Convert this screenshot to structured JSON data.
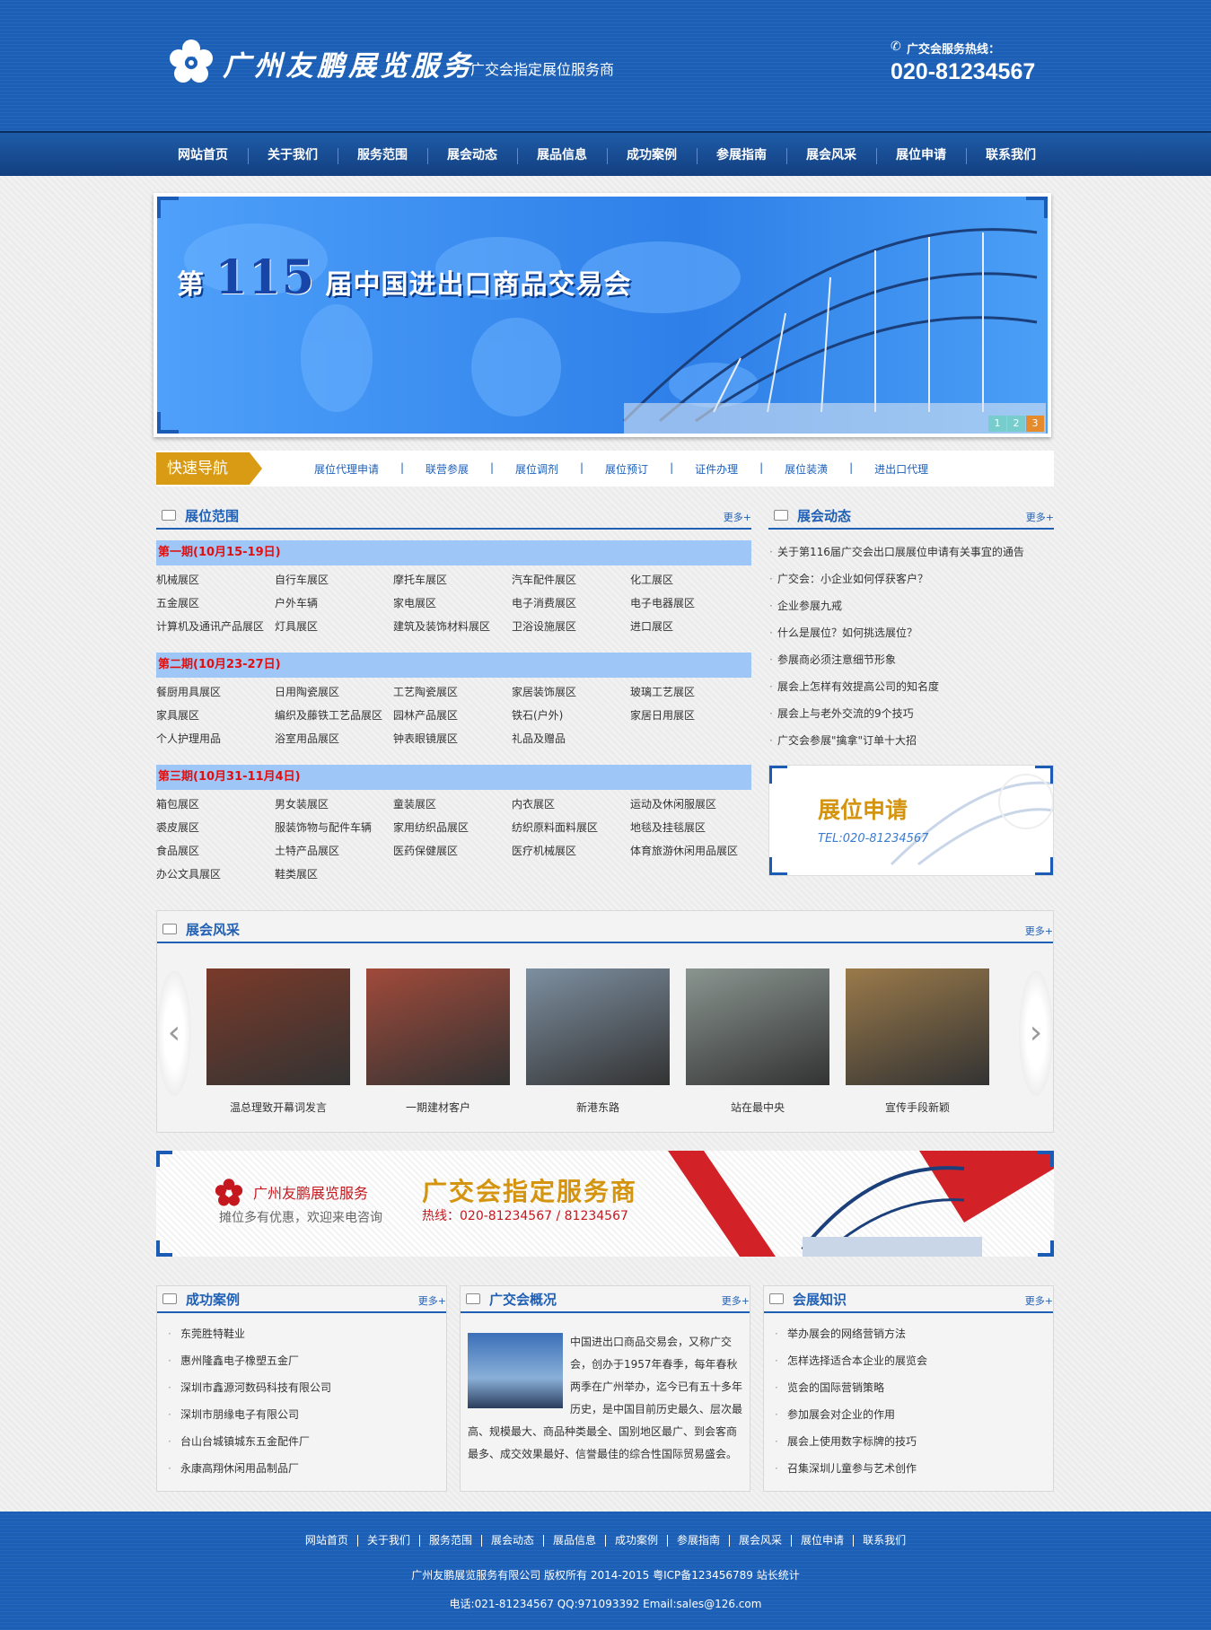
{
  "header": {
    "brand": "广州友鹏展览服务",
    "slogan": "广交会指定展位服务商",
    "hotline_label": "广交会服务热线：",
    "hotline_number": "020-81234567"
  },
  "nav": [
    "网站首页",
    "关于我们",
    "服务范围",
    "展会动态",
    "展品信息",
    "成功案例",
    "参展指南",
    "展会风采",
    "展位申请",
    "联系我们"
  ],
  "banner": {
    "prefix": "第",
    "number": "115",
    "suffix": "届中国进出口商品交易会",
    "dots": [
      "1",
      "2",
      "3"
    ],
    "active_dot": 3
  },
  "quick_nav": {
    "title": "快速导航",
    "links": [
      "展位代理申请",
      "联营参展",
      "展位调剂",
      "展位预订",
      "证件办理",
      "展位装潢",
      "进出口代理"
    ]
  },
  "scope": {
    "title": "展位范围",
    "more": "更多+",
    "periods": [
      {
        "label": "第一期(10月15-19日)",
        "items": [
          "机械展区",
          "自行车展区",
          "摩托车展区",
          "汽车配件展区",
          "化工展区",
          "五金展区",
          "户外车辆",
          "家电展区",
          "电子消费展区",
          "电子电器展区",
          "计算机及通讯产品展区",
          "灯具展区",
          "建筑及装饰材料展区",
          "卫浴设施展区",
          "进口展区"
        ]
      },
      {
        "label": "第二期(10月23-27日)",
        "items": [
          "餐厨用具展区",
          "日用陶瓷展区",
          "工艺陶瓷展区",
          "家居装饰展区",
          "玻璃工艺展区",
          "家具展区",
          "编织及藤铁工艺品展区",
          "园林产品展区",
          "铁石(户外)",
          "家居日用展区",
          "个人护理用品",
          "浴室用品展区",
          "钟表眼镜展区",
          "礼品及赠品"
        ]
      },
      {
        "label": "第三期(10月31-11月4日)",
        "items": [
          "箱包展区",
          "男女装展区",
          "童装展区",
          "内衣展区",
          "运动及休闲服展区",
          "裘皮展区",
          "服装饰物与配件车辆",
          "家用纺织品展区",
          "纺织原料面料展区",
          "地毯及挂毯展区",
          "食品展区",
          "土特产品展区",
          "医药保健展区",
          "医疗机械展区",
          "体育旅游休闲用品展区",
          "办公文具展区",
          "鞋类展区"
        ]
      }
    ]
  },
  "news": {
    "title": "展会动态",
    "more": "更多+",
    "items": [
      "关于第116届广交会出口展展位申请有关事宜的通告",
      "广交会：小企业如何俘获客户？",
      "企业参展九戒",
      "什么是展位？如何挑选展位？",
      "参展商必须注意细节形象",
      "展会上怎样有效提高公司的知名度",
      "展会上与老外交流的9个技巧",
      "广交会参展\"擒拿\"订单十大招"
    ]
  },
  "apply": {
    "title": "展位申请",
    "tel": "TEL:020-81234567"
  },
  "gallery": {
    "title": "展会风采",
    "more": "更多+",
    "items": [
      {
        "caption": "温总理致开幕词发言",
        "color": "#7a3a2a"
      },
      {
        "caption": "一期建材客户",
        "color": "#a04a3a"
      },
      {
        "caption": "新港东路",
        "color": "#7d8fa0"
      },
      {
        "caption": "站在最中央",
        "color": "#8a9590"
      },
      {
        "caption": "宣传手段新颖",
        "color": "#9a7a4a"
      }
    ]
  },
  "ad": {
    "brand": "广州友鹏展览服务",
    "sub": "摊位多有优惠，欢迎来电咨询",
    "main": "广交会指定服务商",
    "tel": "热线：020-81234567 / 81234567"
  },
  "cases": {
    "title": "成功案例",
    "more": "更多+",
    "items": [
      "东莞胜特鞋业",
      "惠州隆鑫电子橡塑五金厂",
      "深圳市鑫源河数码科技有限公司",
      "深圳市朋缘电子有限公司",
      "台山台城镇城东五金配件厂",
      "永康高翔休闲用品制品厂"
    ]
  },
  "overview": {
    "title": "广交会概况",
    "more": "更多+",
    "text": "中国进出口商品交易会，又称广交会，创办于1957年春季，每年春秋两季在广州举办，迄今已有五十多年历史，是中国目前历史最久、层次最高、规模最大、商品种类最全、国别地区最广、到会客商最多、成交效果最好、信誉最佳的综合性国际贸易盛会。"
  },
  "knowledge": {
    "title": "会展知识",
    "more": "更多+",
    "items": [
      "举办展会的网络营销方法",
      "怎样选择适合本企业的展览会",
      "览会的国际营销策略",
      "参加展会对企业的作用",
      "展会上使用数字标牌的技巧",
      "召集深圳儿童参与艺术创作"
    ]
  },
  "footer": {
    "nav": [
      "网站首页",
      "关于我们",
      "服务范围",
      "展会动态",
      "展品信息",
      "成功案例",
      "参展指南",
      "展会风采",
      "展位申请",
      "联系我们"
    ],
    "copyright": "广州友鹏展览服务有限公司 版权所有 2014-2015 粤ICP备123456789 站长统计",
    "contact": "电话:021-81234567 QQ:971093392 Email:sales@126.com"
  },
  "colors": {
    "primary": "#1b5fb6",
    "accent": "#d99a14",
    "period_bg": "#9ec6f7",
    "period_text": "#e01010"
  }
}
